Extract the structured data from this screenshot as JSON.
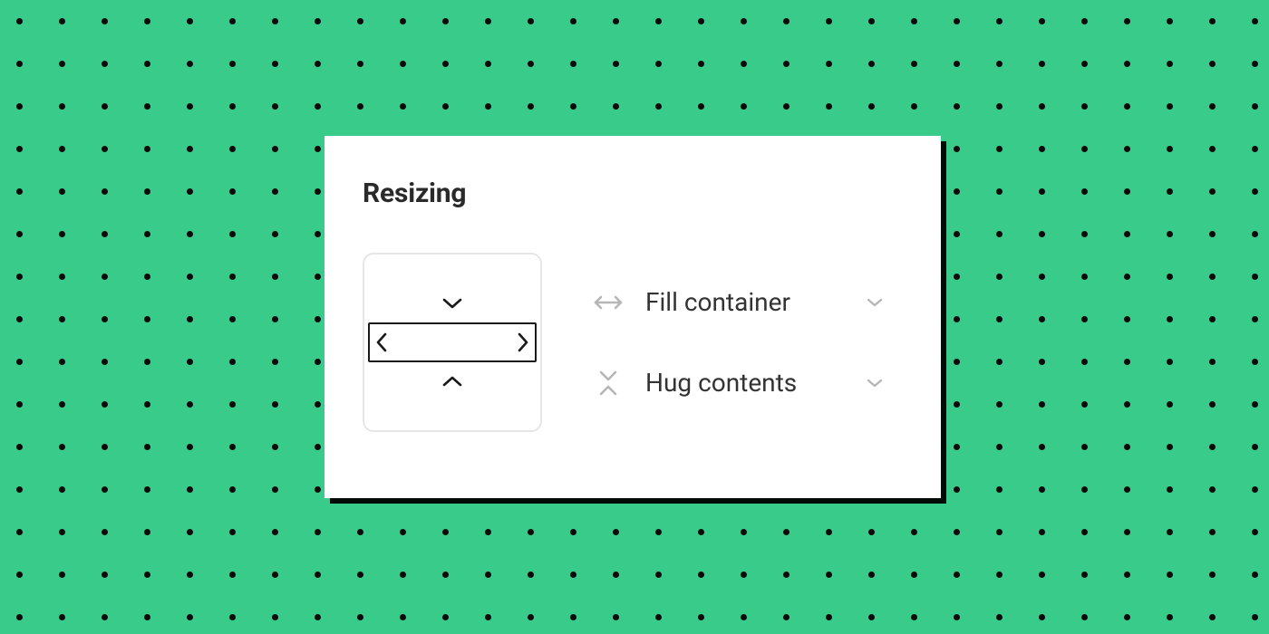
{
  "panel": {
    "title": "Resizing"
  },
  "options": {
    "horizontal": {
      "label": "Fill container"
    },
    "vertical": {
      "label": "Hug contents"
    }
  },
  "icons": {
    "chevron_left": "chevron-left",
    "chevron_right": "chevron-right",
    "chevron_down": "chevron-down",
    "chevron_up": "chevron-up",
    "arrows_h": "arrows-horizontal",
    "hug_v": "hug-vertical",
    "caret": "caret-down"
  },
  "colors": {
    "bg": "#38cb89",
    "panel": "#ffffff",
    "text": "#2a2a2a",
    "muted": "#b6b6b6",
    "border_light": "#e6e6e6",
    "border_dark": "#1a1a1a"
  }
}
